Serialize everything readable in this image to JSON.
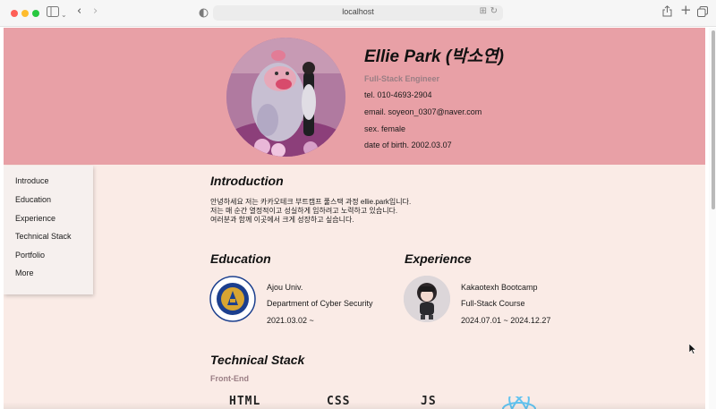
{
  "browser": {
    "url": "localhost"
  },
  "header": {
    "name": "Ellie Park (박소연)",
    "role": "Full-Stack Engineer",
    "tel": "tel. 010-4693-2904",
    "email": "email. soyeon_0307@naver.com",
    "sex": "sex. female",
    "birth": "date of birth. 2002.03.07"
  },
  "nav": {
    "items": [
      {
        "label": "Introduce"
      },
      {
        "label": "Education"
      },
      {
        "label": "Experience"
      },
      {
        "label": "Technical Stack"
      },
      {
        "label": "Portfolio"
      },
      {
        "label": "More"
      }
    ]
  },
  "introduction": {
    "title": "Introduction",
    "lines": [
      "안녕하세요 저는 카카오테크 부트캠프 풀스택 과정 ellie.park입니다.",
      "저는 매 순간 열정적이고 성실하게 임하려고 노력하고 있습니다.",
      "여러분과 함께 이곳에서 크게 성장하고 싶습니다."
    ]
  },
  "education": {
    "title": "Education",
    "school": "Ajou Univ.",
    "department": "Department of Cyber Security",
    "period": "2021.03.02 ~",
    "logo_text": "아주대학교",
    "logo_sub": "AJOU UNIVERSITY",
    "logo_year": "1973"
  },
  "experience": {
    "title": "Experience",
    "company": "Kakaotexh Bootcamp",
    "course": "Full-Stack Course",
    "period": "2024.07.01 ~ 2024.12.27"
  },
  "technical_stack": {
    "title": "Technical Stack",
    "front_end_label": "Front-End",
    "items": [
      "HTML",
      "CSS",
      "JS"
    ]
  },
  "colors": {
    "header_bg": "#e8a0a6",
    "page_bg": "#faebe6",
    "accent_muted": "#9a7e84"
  }
}
